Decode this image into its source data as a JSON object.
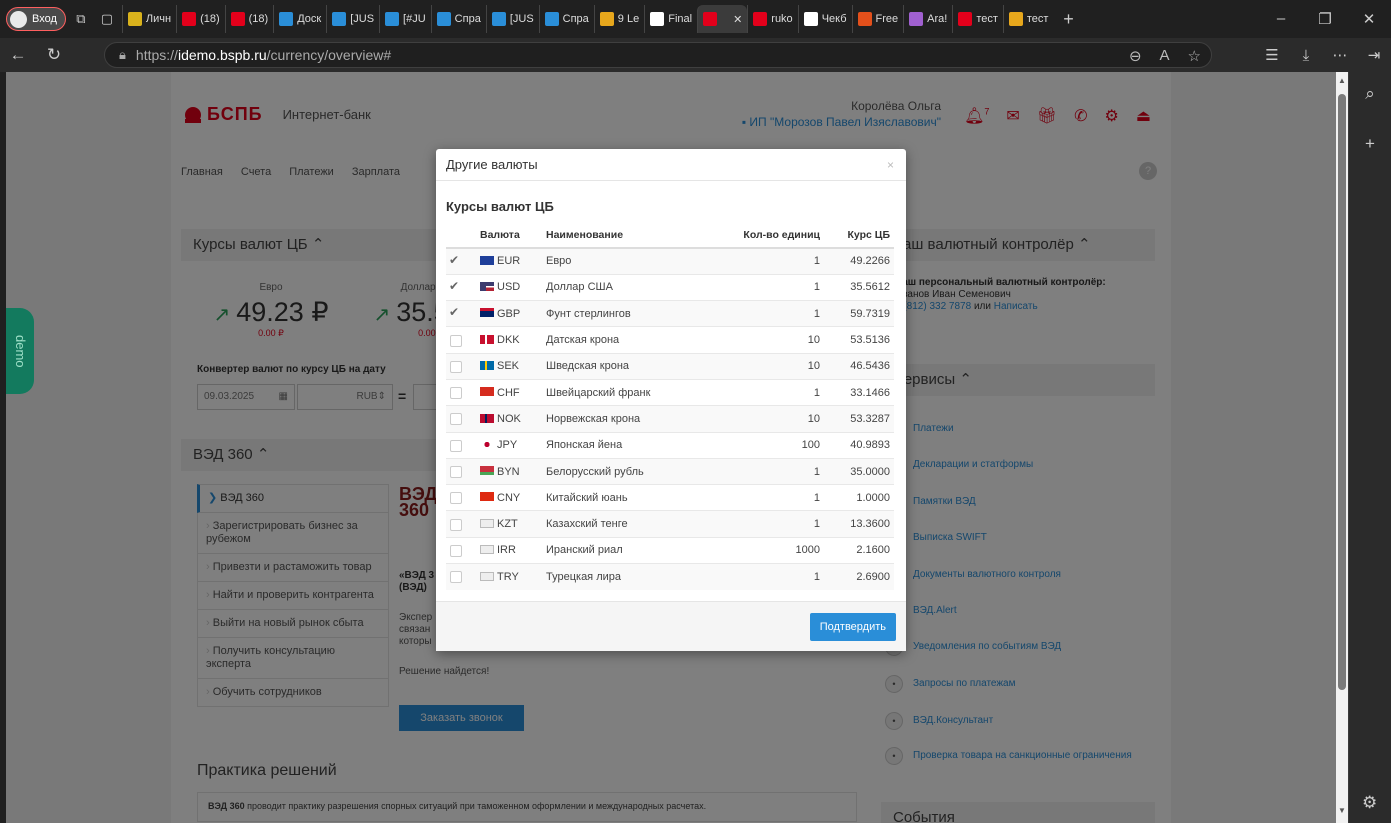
{
  "browser": {
    "profile_label": "Вход",
    "tabs": [
      {
        "label": "Личн",
        "color": "#d9b21c"
      },
      {
        "label": "(18)",
        "color": "#e3001b"
      },
      {
        "label": "(18)",
        "color": "#e3001b"
      },
      {
        "label": "Доск",
        "color": "#2a8ed8"
      },
      {
        "label": "[JUS",
        "color": "#2a8ed8"
      },
      {
        "label": "[#JU",
        "color": "#2a8ed8"
      },
      {
        "label": "Спра",
        "color": "#2a8ed8"
      },
      {
        "label": "[JUS",
        "color": "#2a8ed8"
      },
      {
        "label": "Спра",
        "color": "#2a8ed8"
      },
      {
        "label": "9 Le",
        "color": "#e7a71c"
      },
      {
        "label": "Final",
        "color": "#ffffff"
      },
      {
        "label": "",
        "color": "#e3001b",
        "active": true
      },
      {
        "label": "ruko",
        "color": "#e3001b"
      },
      {
        "label": "Чекб",
        "color": "#ffffff"
      },
      {
        "label": "Free",
        "color": "#e3501b"
      },
      {
        "label": "Ara!",
        "color": "#a060d0"
      },
      {
        "label": "тест",
        "color": "#e3001b"
      },
      {
        "label": "тест",
        "color": "#e7a71c"
      }
    ],
    "url_prefix": "https://",
    "url_host": "idemo.bspb.ru",
    "url_path": "/currency/overview#"
  },
  "header": {
    "bank_name": "БСПБ",
    "bank_sub": "Интернет-банк",
    "user_name": "Королёва Ольга",
    "org_name": "ИП \"Морозов Павел Изяславович\"",
    "notif_count": "7"
  },
  "menu": [
    "Главная",
    "Счета",
    "Платежи",
    "Зарплата"
  ],
  "rates_panel": {
    "title": "Курсы валют ЦБ",
    "euro_cap": "Евро",
    "euro_val": "49.23 ₽",
    "euro_delta": "0.00 ₽",
    "usd_cap": "Доллар США",
    "usd_val": "35.56 ₽",
    "usd_delta": "0.00 ₽",
    "converter_title": "Конвертер валют по курсу ЦБ на дату",
    "date_value": "09.03.2025",
    "currency_value": "RUB"
  },
  "ved": {
    "title": "ВЭД 360",
    "items": [
      "ВЭД 360",
      "Зарегистрировать бизнес за рубежом",
      "Привезти и растаможить товар",
      "Найти и проверить контрагента",
      "Выйти на новый рынок сбыта",
      "Получить консультацию эксперта",
      "Обучить сотрудников"
    ],
    "logo_text": "ВЭД 360",
    "promo_title": "«ВЭД 3 (ВЭД)",
    "promo_text": "Экспер связан которы",
    "solution": "Решение найдется!",
    "call_button": "Заказать звонок"
  },
  "practice": {
    "title": "Практика решений",
    "text_bold": "ВЭД 360",
    "text": " проводит практику разрешения спорных ситуаций при таможенном оформлении и международных расчетах."
  },
  "controller": {
    "title": "Ваш валютный контролёр",
    "label": "Ваш персональный валютный контролёр:",
    "person": "Иванов Иван Семенович",
    "phone": "8 (812) 332 7878",
    "or_text": " или ",
    "write": "Написать"
  },
  "services": {
    "title": "Сервисы",
    "items": [
      {
        "label": "Платежи",
        "icon": "payment-icon"
      },
      {
        "label": "Декларации и статформы",
        "icon": "declaration-icon"
      },
      {
        "label": "Памятки ВЭД",
        "icon": "memo-icon"
      },
      {
        "label": "Выписка SWIFT",
        "icon": "swift-icon"
      },
      {
        "label": "Документы валютного контроля",
        "icon": "documents-icon"
      },
      {
        "label": "ВЭД.Alert",
        "icon": "alert-icon"
      },
      {
        "label": "Уведомления по событиям ВЭД",
        "icon": "notify-icon"
      },
      {
        "label": "Запросы по платежам",
        "icon": "request-icon"
      },
      {
        "label": "ВЭД.Консультант",
        "icon": "consultant-icon"
      },
      {
        "label": "Проверка товара на санкционные ограничения",
        "icon": "check-icon"
      }
    ]
  },
  "events_title": "События",
  "demo_label": "demo",
  "modal": {
    "title": "Другие валюты",
    "close": "×",
    "subtitle": "Курсы валют ЦБ",
    "headers": [
      "Валюта",
      "Наименование",
      "Кол-во единиц",
      "Курс ЦБ"
    ],
    "rows": [
      {
        "checked": true,
        "code": "EUR",
        "name": "Евро",
        "units": "1",
        "rate": "49.2266",
        "flag": "eu"
      },
      {
        "checked": true,
        "code": "USD",
        "name": "Доллар США",
        "units": "1",
        "rate": "35.5612",
        "flag": "us"
      },
      {
        "checked": true,
        "code": "GBP",
        "name": "Фунт стерлингов",
        "units": "1",
        "rate": "59.7319",
        "flag": "gb"
      },
      {
        "checked": false,
        "code": "DKK",
        "name": "Датская крона",
        "units": "10",
        "rate": "53.5136",
        "flag": "dk"
      },
      {
        "checked": false,
        "code": "SEK",
        "name": "Шведская крона",
        "units": "10",
        "rate": "46.5436",
        "flag": "se"
      },
      {
        "checked": false,
        "code": "CHF",
        "name": "Швейцарский франк",
        "units": "1",
        "rate": "33.1466",
        "flag": "ch"
      },
      {
        "checked": false,
        "code": "NOK",
        "name": "Норвежская крона",
        "units": "10",
        "rate": "53.3287",
        "flag": "no"
      },
      {
        "checked": false,
        "code": "JPY",
        "name": "Японская йена",
        "units": "100",
        "rate": "40.9893",
        "flag": "jp"
      },
      {
        "checked": false,
        "code": "BYN",
        "name": "Белорусский рубль",
        "units": "1",
        "rate": "35.0000",
        "flag": "by"
      },
      {
        "checked": false,
        "code": "CNY",
        "name": "Китайский юань",
        "units": "1",
        "rate": "1.0000",
        "flag": "cn"
      },
      {
        "checked": false,
        "code": "KZT",
        "name": "Казахский тенге",
        "units": "1",
        "rate": "13.3600",
        "flag": "broken"
      },
      {
        "checked": false,
        "code": "IRR",
        "name": "Иранский риал",
        "units": "1000",
        "rate": "2.1600",
        "flag": "broken"
      },
      {
        "checked": false,
        "code": "TRY",
        "name": "Турецкая лира",
        "units": "1",
        "rate": "2.6900",
        "flag": "broken"
      }
    ],
    "confirm_button": "Подтвердить"
  }
}
